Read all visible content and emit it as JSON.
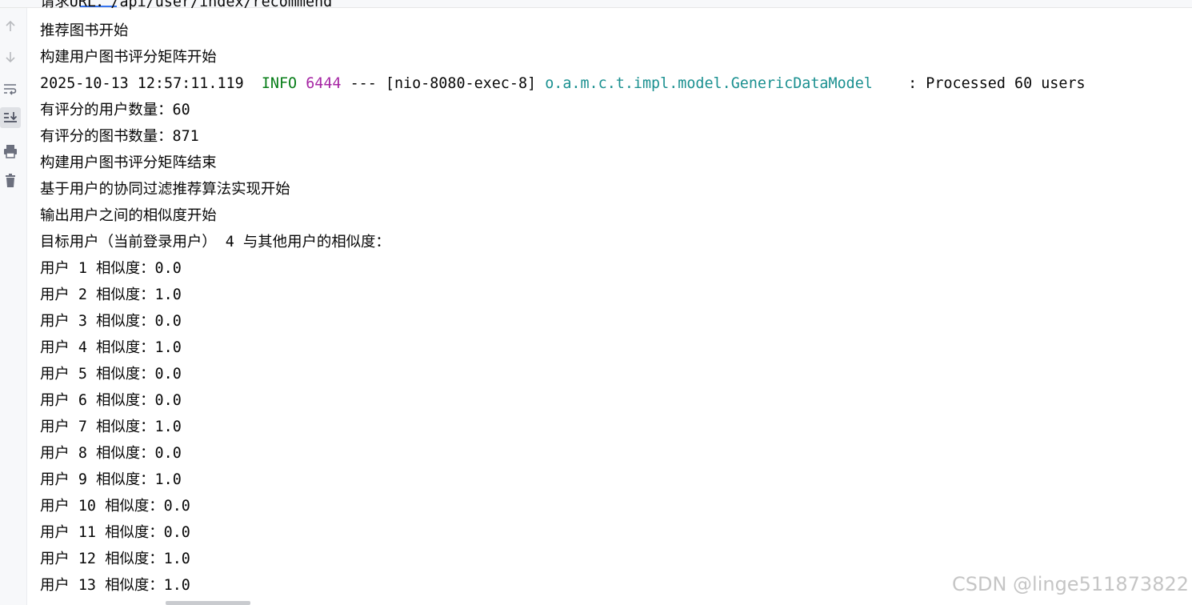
{
  "toolbar": {
    "items": [
      {
        "icon": "arrow-up-icon",
        "label": "Up"
      },
      {
        "icon": "arrow-down-icon",
        "label": "Down"
      },
      {
        "icon": "soft-wrap-icon",
        "label": "Soft-wrap"
      },
      {
        "icon": "scroll-to-end-icon",
        "label": "Scroll to end"
      },
      {
        "icon": "print-icon",
        "label": "Print"
      },
      {
        "icon": "trash-icon",
        "label": "Clear all"
      }
    ]
  },
  "console": {
    "partial_top_line": "请求URL：/api/user/index/recommend",
    "lines": [
      "推荐图书开始",
      "构建用户图书评分矩阵开始"
    ],
    "log": {
      "timestamp": "2025-10-13 12:57:11.119",
      "level": "INFO",
      "pid": "6444",
      "sep": "---",
      "thread": "[nio-8080-exec-8]",
      "logger": "o.a.m.c.t.impl.model.GenericDataModel",
      "message": ": Processed 60 users"
    },
    "lines_after": [
      "有评分的用户数量：60",
      "有评分的图书数量：871",
      "构建用户图书评分矩阵结束",
      "基于用户的协同过滤推荐算法实现开始",
      "输出用户之间的相似度开始",
      "目标用户（当前登录用户） 4 与其他用户的相似度：",
      "用户 1 相似度：0.0",
      "用户 2 相似度：1.0",
      "用户 3 相似度：0.0",
      "用户 4 相似度：1.0",
      "用户 5 相似度：0.0",
      "用户 6 相似度：0.0",
      "用户 7 相似度：1.0",
      "用户 8 相似度：0.0",
      "用户 9 相似度：1.0",
      "用户 10 相似度：0.0",
      "用户 11 相似度：0.0",
      "用户 12 相似度：1.0",
      "用户 13 相似度：1.0"
    ]
  },
  "watermark": "CSDN @linge511873822",
  "colors": {
    "info": "#067d17",
    "pid": "#a626a4",
    "logger": "#1a9090",
    "text": "#080808"
  }
}
